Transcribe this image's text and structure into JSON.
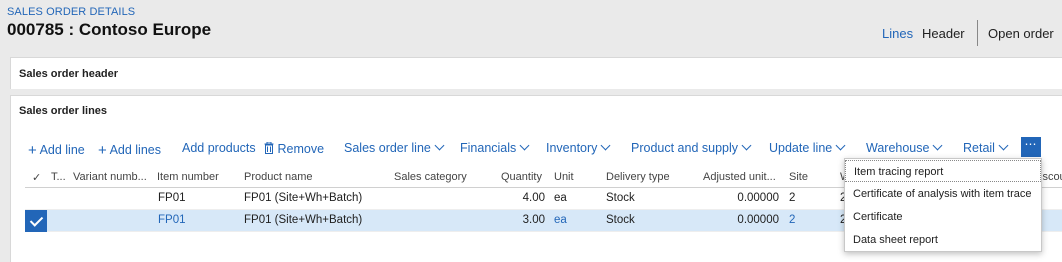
{
  "header": {
    "breadcrumb": "SALES ORDER DETAILS",
    "title": "000785 : Contoso Europe",
    "views": [
      "Lines",
      "Header",
      "Open order"
    ]
  },
  "sections": {
    "header_tab": "Sales order header",
    "lines_tab": "Sales order lines"
  },
  "toolbar": {
    "add_line": "Add line",
    "add_lines": "Add lines",
    "add_products": "Add products",
    "remove": "Remove",
    "menus": [
      "Sales order line",
      "Financials",
      "Inventory",
      "Product and supply",
      "Update line",
      "Warehouse",
      "Retail"
    ],
    "more": "⋯"
  },
  "grid": {
    "columns": [
      "T...",
      "Variant numb...",
      "Item number",
      "Product name",
      "Sales category",
      "Quantity",
      "Unit",
      "Delivery type",
      "Adjusted unit...",
      "Site",
      "W",
      "iscoun"
    ],
    "rows": [
      {
        "item": "FP01",
        "product": "FP01 (Site+Wh+Batch)",
        "category": "",
        "quantity": "4.00",
        "unit": "ea",
        "delivery": "Stock",
        "adjusted": "0.00000",
        "site": "2",
        "w": "2",
        "selected": false
      },
      {
        "item": "FP01",
        "product": "FP01 (Site+Wh+Batch)",
        "category": "",
        "quantity": "3.00",
        "unit": "ea",
        "delivery": "Stock",
        "adjusted": "0.00000",
        "site": "2",
        "w": "2",
        "selected": true
      }
    ]
  },
  "dropdown": {
    "items": [
      "Item tracing report",
      "Certificate of analysis with item trace",
      "Certificate",
      "Data sheet report"
    ]
  },
  "colors": {
    "accent": "#2266b8",
    "selected_row": "#d7e8f8",
    "background": "#eaeaea"
  }
}
